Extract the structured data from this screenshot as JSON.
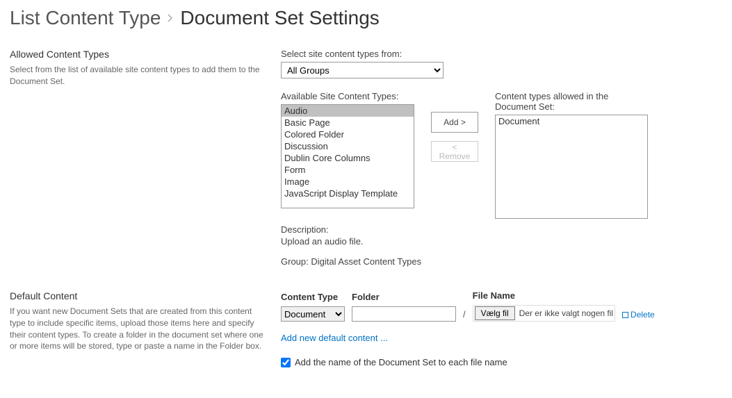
{
  "breadcrumb": {
    "parent": "List Content Type",
    "current": "Document Set Settings"
  },
  "allowed": {
    "heading": "Allowed Content Types",
    "desc": "Select from the list of available site content types to add them to the Document Set.",
    "select_from_label": "Select site content types from:",
    "group_value": "All Groups",
    "available_label": "Available Site Content Types:",
    "allowed_label_l1": "Content types allowed in the",
    "allowed_label_l2": "Document Set:",
    "add_btn": "Add >",
    "remove_btn_l1": "<",
    "remove_btn_l2": "Remove",
    "available_items": [
      "Audio",
      "Basic Page",
      "Colored Folder",
      "Discussion",
      "Dublin Core Columns",
      "Form",
      "Image",
      "JavaScript Display Template"
    ],
    "allowed_items": [
      "Document"
    ],
    "description_label": "Description:",
    "description_text": "Upload an audio file.",
    "group_text": "Group: Digital Asset Content Types"
  },
  "default": {
    "heading": "Default Content",
    "desc": "If you want new Document Sets that are created from this content type to include specific items, upload those items here and specify their content types. To create a folder in the document set where one or more items will be stored, type or paste a name in the Folder box.",
    "col_contenttype": "Content Type",
    "col_folder": "Folder",
    "col_filename": "File Name",
    "contenttype_value": "Document",
    "file_button": "Vælg fil",
    "no_file_text": "Der er ikke valgt nogen fil",
    "delete_link": "Delete",
    "add_new_link": "Add new default content ...",
    "addname_label": "Add the name of the Document Set to each file name"
  }
}
